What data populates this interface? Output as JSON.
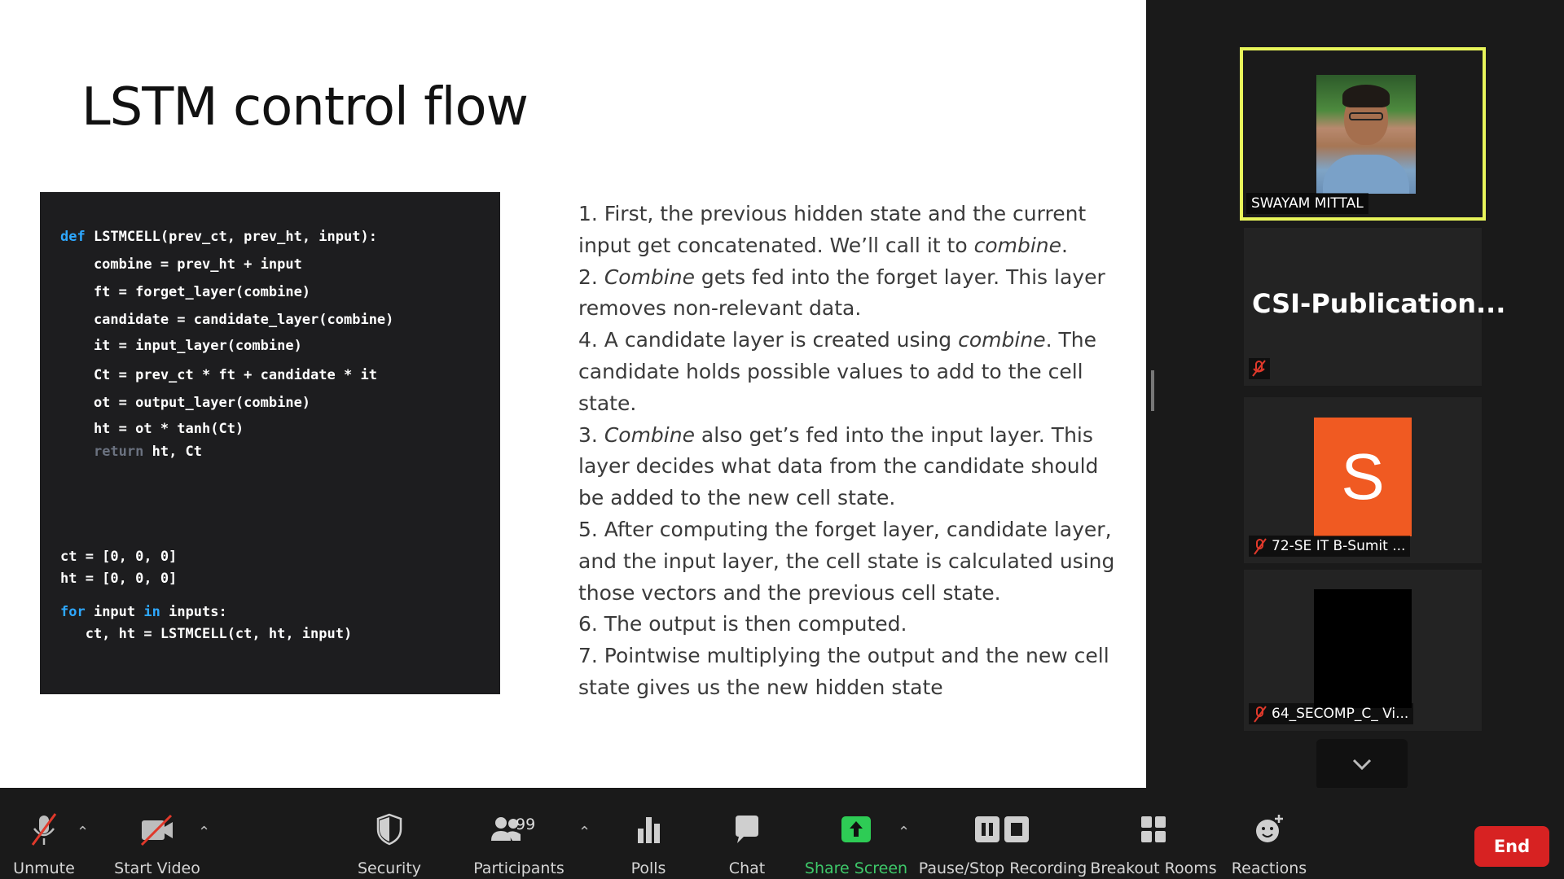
{
  "slide": {
    "title": "LSTM control flow",
    "code": [
      {
        "parts": [
          {
            "t": "def",
            "c": "kw-blue"
          },
          {
            "t": " LSTMCELL(prev_ct, prev_ht, input):"
          }
        ]
      },
      {
        "parts": [
          {
            "t": "    combine = prev_ht + input"
          }
        ]
      },
      {
        "parts": [
          {
            "t": "    ft = forget_layer(combine)"
          }
        ]
      },
      {
        "parts": [
          {
            "t": "    candidate = candidate_layer(combine)"
          }
        ]
      },
      {
        "parts": [
          {
            "t": "    it = input_layer(combine)"
          }
        ]
      },
      {
        "parts": [
          {
            "t": "    Ct = prev_ct * ft + candidate * it"
          }
        ]
      },
      {
        "parts": [
          {
            "t": "    ot = output_layer(combine)"
          }
        ]
      },
      {
        "parts": [
          {
            "t": "    ht = ot * tanh(Ct)"
          }
        ]
      },
      {
        "parts": [
          {
            "t": "    "
          },
          {
            "t": "return",
            "c": "kw-dim"
          },
          {
            "t": " ht, Ct"
          }
        ]
      },
      {
        "parts": [
          {
            "t": "ct = [0, 0, 0]"
          }
        ]
      },
      {
        "parts": [
          {
            "t": "ht = [0, 0, 0]"
          }
        ]
      },
      {
        "parts": [
          {
            "t": "for",
            "c": "kw-blue"
          },
          {
            "t": " input "
          },
          {
            "t": "in",
            "c": "kw-blue"
          },
          {
            "t": " inputs:"
          }
        ]
      },
      {
        "parts": [
          {
            "t": "   ct, ht = LSTMCELL(ct, ht, input)"
          }
        ]
      }
    ],
    "steps": [
      {
        "parts": [
          {
            "t": "1. First, the previous hidden state and the current input get concatenated. We’ll call it to "
          },
          {
            "t": "combine",
            "i": true
          },
          {
            "t": "."
          }
        ]
      },
      {
        "parts": [
          {
            "t": "2. "
          },
          {
            "t": "Combine",
            "i": true
          },
          {
            "t": " gets fed into the forget layer. This layer removes non-relevant data."
          }
        ]
      },
      {
        "parts": [
          {
            "t": "4. A candidate layer is created using "
          },
          {
            "t": "combine",
            "i": true
          },
          {
            "t": ". The candidate holds possible values to add to the cell state."
          }
        ]
      },
      {
        "parts": [
          {
            "t": "3. "
          },
          {
            "t": "Combine",
            "i": true
          },
          {
            "t": " also get’s fed into the input layer. This layer decides what data from the candidate should be added to the new cell state."
          }
        ]
      },
      {
        "parts": [
          {
            "t": "5. After computing the forget layer, candidate layer, and the input layer, the cell state is calculated using those vectors and the previous cell state."
          }
        ]
      },
      {
        "parts": [
          {
            "t": "6. The output is then computed."
          }
        ]
      },
      {
        "parts": [
          {
            "t": "7. Pointwise multiplying the output and the new cell state gives us the new hidden state"
          }
        ]
      }
    ]
  },
  "participants": {
    "active_speaker": {
      "name": "SWAYAM MITTAL"
    },
    "tile2": {
      "display_name": "CSI-Publication..."
    },
    "tile3": {
      "initial": "S",
      "name": "72-SE IT B-Sumit ..."
    },
    "tile4": {
      "name": "64_SECOMP_C_ Vi..."
    }
  },
  "toolbar": {
    "unmute": "Unmute",
    "start_video": "Start Video",
    "security": "Security",
    "participants": "Participants",
    "participants_count": "99",
    "polls": "Polls",
    "chat": "Chat",
    "share_screen": "Share Screen",
    "recording": "Pause/Stop Recording",
    "breakout": "Breakout Rooms",
    "reactions": "Reactions",
    "end": "End"
  },
  "colors": {
    "accent_green": "#3ec96a",
    "end_red": "#d72222",
    "active_border": "#e8f55a",
    "code_keyword": "#2ea8ff"
  }
}
